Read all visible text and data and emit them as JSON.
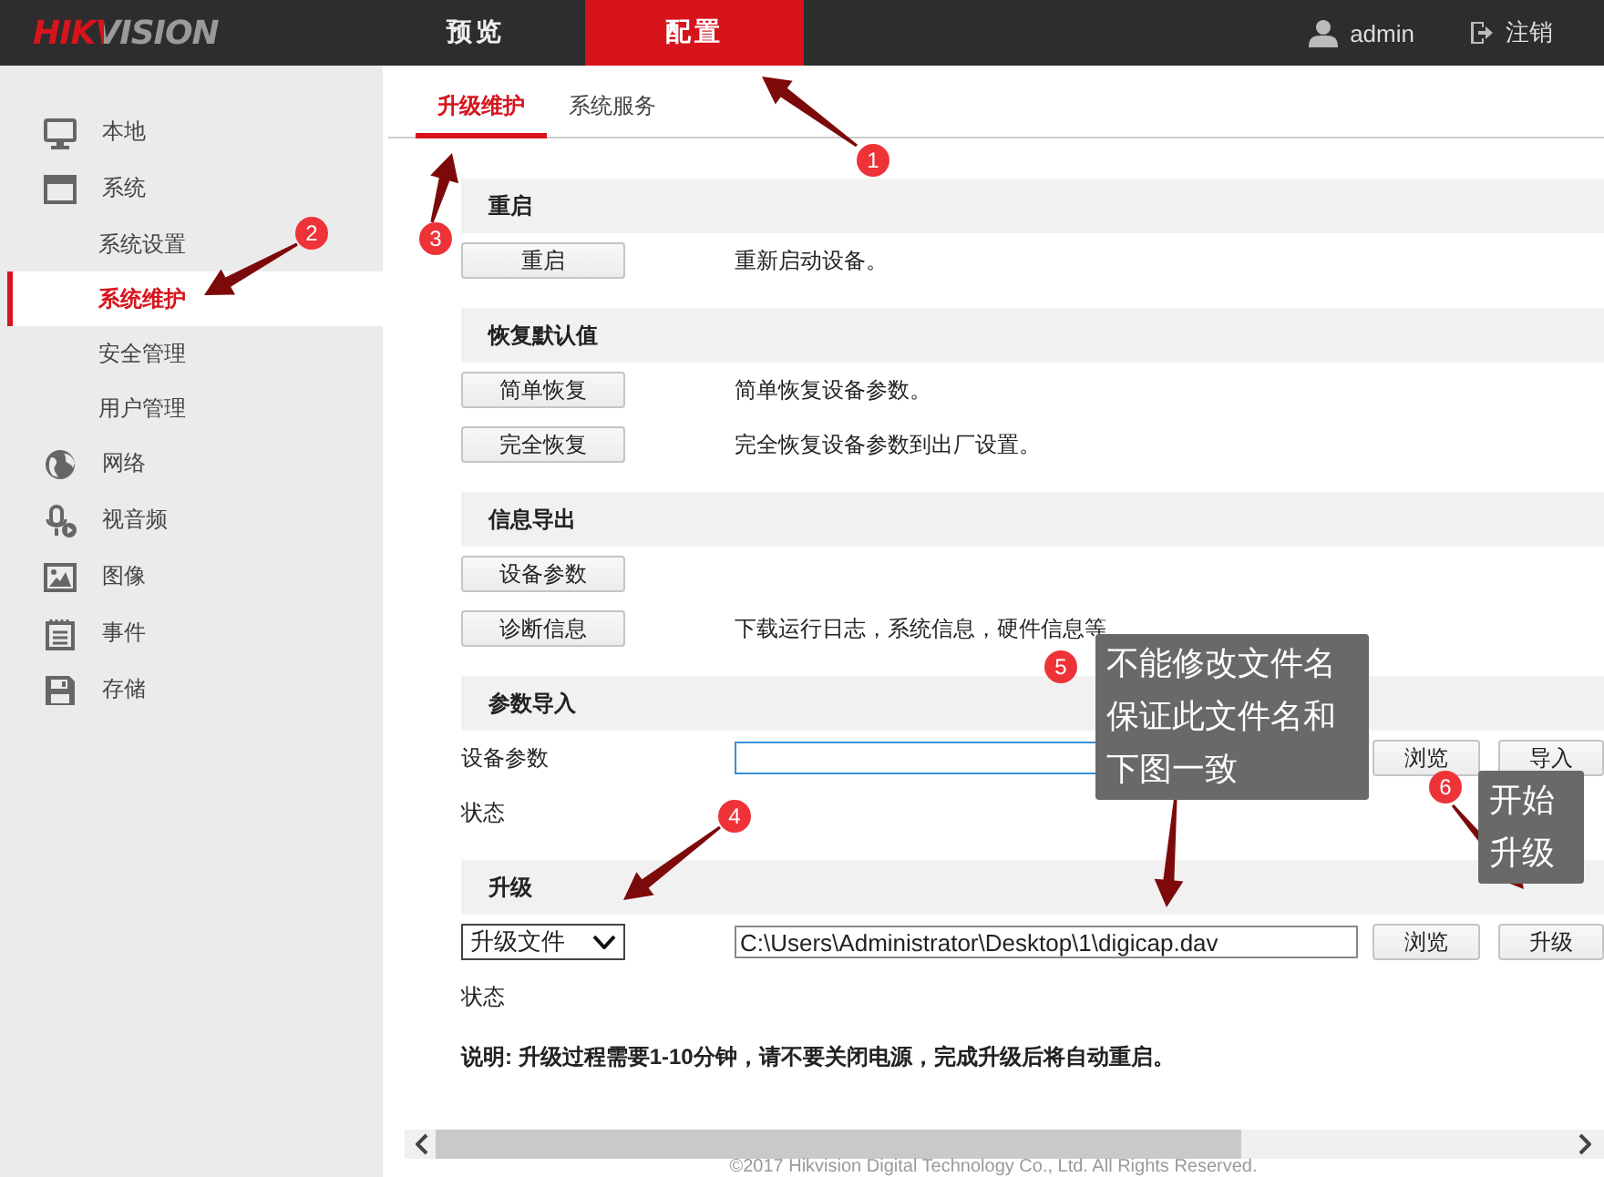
{
  "header": {
    "logo": "HIKVISION",
    "nav": [
      {
        "label": "预览",
        "selected": false
      },
      {
        "label": "配置",
        "selected": true
      }
    ],
    "user": "admin",
    "logout": "注销"
  },
  "sidebar": {
    "items": [
      {
        "label": "本地",
        "selected": false
      },
      {
        "label": "系统",
        "selected": false,
        "children": [
          {
            "label": "系统设置",
            "selected": false
          },
          {
            "label": "系统维护",
            "selected": true
          },
          {
            "label": "安全管理",
            "selected": false
          },
          {
            "label": "用户管理",
            "selected": false
          }
        ]
      },
      {
        "label": "网络",
        "selected": false
      },
      {
        "label": "视音频",
        "selected": false
      },
      {
        "label": "图像",
        "selected": false
      },
      {
        "label": "事件",
        "selected": false
      },
      {
        "label": "存储",
        "selected": false
      }
    ]
  },
  "main": {
    "tabs": [
      {
        "label": "升级维护",
        "selected": true
      },
      {
        "label": "系统服务",
        "selected": false
      }
    ],
    "sections": [
      {
        "title": "重启",
        "rows": [
          {
            "kind": "action",
            "button": "重启",
            "description": "重新启动设备。"
          }
        ]
      },
      {
        "title": "恢复默认值",
        "rows": [
          {
            "kind": "action",
            "button": "简单恢复",
            "description": "简单恢复设备参数。"
          },
          {
            "kind": "action",
            "button": "完全恢复",
            "description": "完全恢复设备参数到出厂设置。"
          }
        ]
      },
      {
        "title": "信息导出",
        "rows": [
          {
            "kind": "action",
            "button": "设备参数"
          },
          {
            "kind": "action",
            "button": "诊断信息",
            "description": "下载运行日志，系统信息，硬件信息等"
          }
        ]
      },
      {
        "title": "参数导入",
        "rows": [
          {
            "kind": "file",
            "label": "设备参数",
            "focused": true,
            "buttons": [
              "浏览",
              "导入"
            ]
          },
          {
            "kind": "status",
            "label": "状态"
          }
        ]
      },
      {
        "title": "升级",
        "rows": [
          {
            "kind": "file",
            "select": "升级文件",
            "value": "C:\\Users\\Administrator\\Desktop\\1\\digicap.dav",
            "focused": false,
            "buttons": [
              "浏览",
              "升级"
            ]
          },
          {
            "kind": "status",
            "label": "状态"
          },
          {
            "kind": "note",
            "text": "说明: 升级过程需要1-10分钟，请不要关闭电源，完成升级后将自动重启。"
          }
        ]
      }
    ],
    "footer": "©2017 Hikvision Digital Technology Co., Ltd. All Rights Reserved."
  },
  "annotations": [
    {
      "number": "1"
    },
    {
      "number": "2"
    },
    {
      "number": "3"
    },
    {
      "number": "4"
    },
    {
      "number": "5",
      "note": "不能修改文件名保证此文件名和下图一致"
    },
    {
      "number": "6",
      "note": "开始升级"
    }
  ]
}
